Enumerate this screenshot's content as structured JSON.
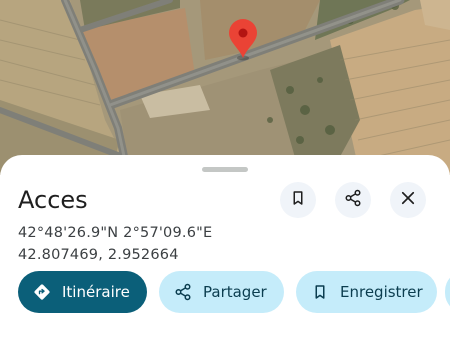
{
  "place": {
    "title": "Acces",
    "coordinates_dms": "42°48'26.9\"N 2°57'09.6\"E",
    "coordinates_decimal": "42.807469, 2.952664"
  },
  "header_actions": {
    "save_icon": "bookmark-icon",
    "share_icon": "share-icon",
    "close_icon": "close-icon"
  },
  "actions": {
    "directions_label": "Itinéraire",
    "share_label": "Partager",
    "save_label": "Enregistrer"
  },
  "map": {
    "type": "satellite",
    "marker_color": "#ea4335"
  },
  "colors": {
    "primary_chip": "#0b5f79",
    "secondary_chip": "#c5ecfa",
    "icon_button": "#f0f4f9"
  }
}
